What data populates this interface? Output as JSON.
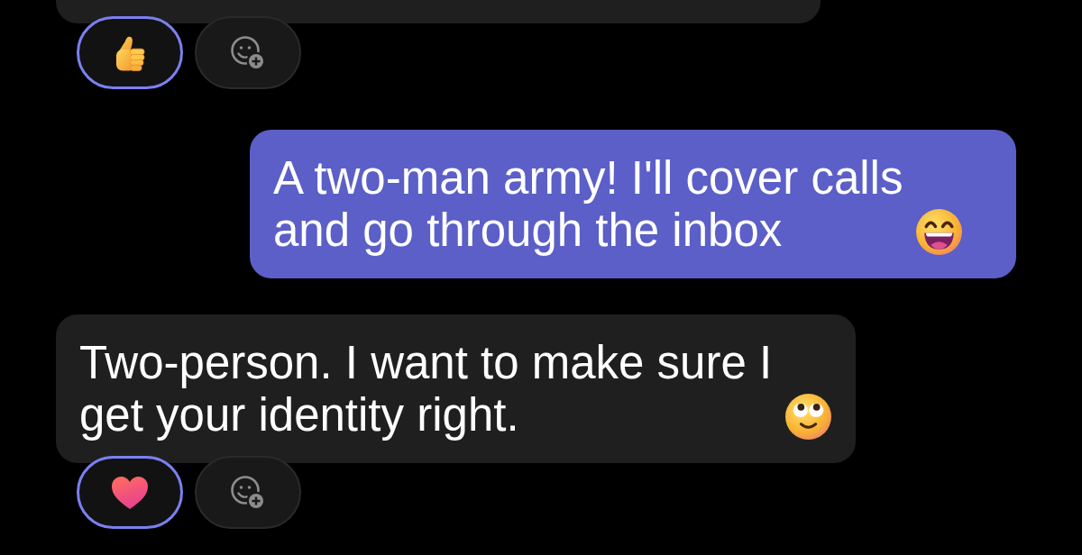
{
  "chat": {
    "messages": [
      {
        "kind": "received",
        "reactions": [
          {
            "selected": true
          }
        ]
      },
      {
        "kind": "sent",
        "text": "A two-man army! I'll cover calls and go through the inbox"
      },
      {
        "kind": "received",
        "text": "Two-person. I want to make sure I get your identity right.",
        "reactions": [
          {
            "selected": true
          }
        ]
      }
    ]
  }
}
